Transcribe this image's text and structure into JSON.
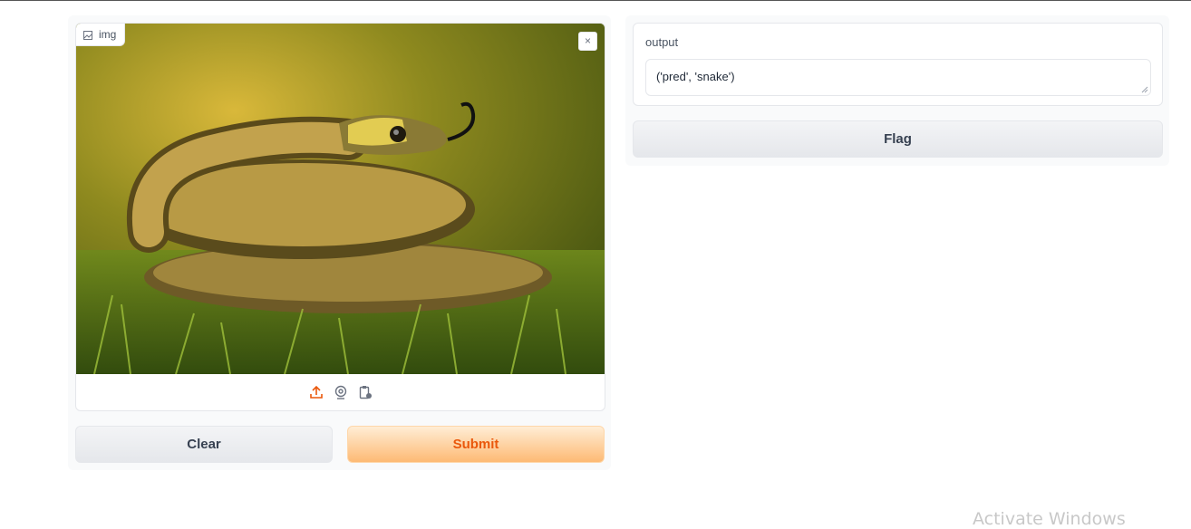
{
  "input": {
    "label": "img",
    "image_subject": "snake coiled in green grass",
    "close_symbol": "×",
    "sources": [
      {
        "icon": "upload-icon",
        "active": true
      },
      {
        "icon": "webcam-icon",
        "active": false
      },
      {
        "icon": "clipboard-icon",
        "active": false
      }
    ]
  },
  "buttons": {
    "clear_label": "Clear",
    "submit_label": "Submit",
    "flag_label": "Flag"
  },
  "output": {
    "label": "output",
    "value": "('pred', 'snake')"
  },
  "watermark": "Activate Windows",
  "colors": {
    "accent": "#ea580c",
    "primary_gradient_top": "#ffedd5",
    "primary_gradient_bottom": "#fdba74"
  }
}
